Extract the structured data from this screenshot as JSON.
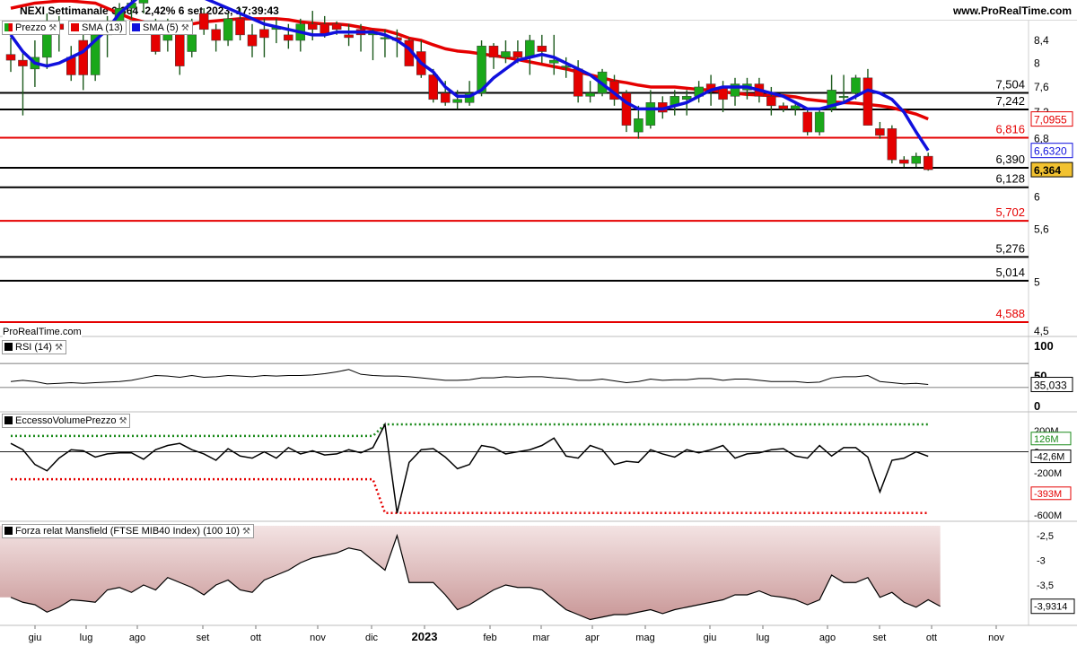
{
  "header": {
    "title": "NEXI Settimanale 6,364 -2,42% 6 set 2023, 17:39:43",
    "site": "www.ProRealTime.com"
  },
  "watermark": "ProRealTime.com",
  "panels": {
    "price": {
      "legend": [
        {
          "label": "Prezzo",
          "color": "#1aa81a"
        },
        {
          "label": "SMA (13)",
          "color": "#e50000"
        },
        {
          "label": "SMA (5)",
          "color": "#1010dd"
        }
      ],
      "yticks": [
        "8,4",
        "8",
        "7,6",
        "7,2",
        "6,8",
        "6",
        "5,6",
        "5",
        "4,5"
      ],
      "tags": [
        {
          "text": "7,0955",
          "color": "#e50000"
        },
        {
          "text": "6,6320",
          "color": "#1010dd"
        },
        {
          "text": "6,364",
          "color": "#000000"
        }
      ],
      "levels": [
        {
          "value": 7.504,
          "label": "7,504",
          "color": "#000000"
        },
        {
          "value": 7.242,
          "label": "7,242",
          "color": "#000000"
        },
        {
          "value": 6.816,
          "label": "6,816",
          "color": "#e50000"
        },
        {
          "value": 6.39,
          "label": "6,390",
          "color": "#000000"
        },
        {
          "value": 6.128,
          "label": "6,128",
          "color": "#000000"
        },
        {
          "value": 5.702,
          "label": "5,702",
          "color": "#e50000"
        },
        {
          "value": 5.276,
          "label": "5,276",
          "color": "#000000"
        },
        {
          "value": 5.014,
          "label": "5,014",
          "color": "#000000"
        },
        {
          "value": 4.588,
          "label": "4,588",
          "color": "#e50000"
        }
      ]
    },
    "rsi": {
      "legend": "RSI (14)",
      "yticks": [
        "100",
        "50",
        "0"
      ],
      "tag": "35,033"
    },
    "excess": {
      "legend": "EccessoVolumePrezzo",
      "yticks": [
        "200M",
        "0",
        "-200M",
        "-600M"
      ],
      "tags": [
        {
          "text": "126M",
          "color": "#1a8a1a"
        },
        {
          "text": "-42,6M",
          "color": "#000000"
        },
        {
          "text": "-393M",
          "color": "#e50000"
        }
      ]
    },
    "mansfield": {
      "legend": "Forza relat Mansfield (FTSE MIB40 Index) (100 10)",
      "yticks": [
        "-2,5",
        "-3",
        "-3,5"
      ],
      "tag": "-3,9314"
    }
  },
  "xaxis": [
    "giu",
    "lug",
    "ago",
    "set",
    "ott",
    "nov",
    "dic",
    "2023",
    "feb",
    "mar",
    "apr",
    "mag",
    "giu",
    "lug",
    "ago",
    "set",
    "ott",
    "nov"
  ],
  "chart_data": [
    {
      "type": "candlestick",
      "title": "NEXI Settimanale",
      "note": "weekly OHLC, approx. first visible week mid-June 2022 to week of 4 Sep 2023",
      "ohlc": [
        [
          8.15,
          8.45,
          7.85,
          8.05
        ],
        [
          8.05,
          8.2,
          7.15,
          7.95
        ],
        [
          7.9,
          8.4,
          7.6,
          8.1
        ],
        [
          8.1,
          8.9,
          7.9,
          8.7
        ],
        [
          8.7,
          8.85,
          8.2,
          8.6
        ],
        [
          8.1,
          8.3,
          7.7,
          7.8
        ],
        [
          8.4,
          8.7,
          7.55,
          7.8
        ],
        [
          7.8,
          8.5,
          7.7,
          8.5
        ],
        [
          8.5,
          8.85,
          8.1,
          8.7
        ],
        [
          8.7,
          9.1,
          8.5,
          9.0
        ],
        [
          9.0,
          9.2,
          8.8,
          9.1
        ],
        [
          9.1,
          9.3,
          8.9,
          9.2
        ],
        [
          8.6,
          8.8,
          8.15,
          8.2
        ],
        [
          8.4,
          8.8,
          8.2,
          8.6
        ],
        [
          8.5,
          8.75,
          7.8,
          7.95
        ],
        [
          8.2,
          8.8,
          8.1,
          8.5
        ],
        [
          8.9,
          9.0,
          8.5,
          8.6
        ],
        [
          8.6,
          8.7,
          8.2,
          8.4
        ],
        [
          8.4,
          8.9,
          8.3,
          8.8
        ],
        [
          8.8,
          9.0,
          8.4,
          8.5
        ],
        [
          8.5,
          8.7,
          8.1,
          8.3
        ],
        [
          8.6,
          8.8,
          8.1,
          8.45
        ],
        [
          8.6,
          8.8,
          8.35,
          8.65
        ],
        [
          8.5,
          8.7,
          8.25,
          8.4
        ],
        [
          8.4,
          8.8,
          8.2,
          8.7
        ],
        [
          8.7,
          8.95,
          8.4,
          8.6
        ],
        [
          8.7,
          8.85,
          8.45,
          8.5
        ],
        [
          8.7,
          8.75,
          8.5,
          8.6
        ],
        [
          8.5,
          8.7,
          8.3,
          8.45
        ],
        [
          8.6,
          8.7,
          8.2,
          8.5
        ],
        [
          8.5,
          8.6,
          8.05,
          8.55
        ],
        [
          8.45,
          8.6,
          8.1,
          8.45
        ],
        [
          8.45,
          8.6,
          8.1,
          8.4
        ],
        [
          8.4,
          8.45,
          7.95,
          7.95
        ],
        [
          8.2,
          8.4,
          7.75,
          7.8
        ],
        [
          7.8,
          7.9,
          7.35,
          7.4
        ],
        [
          7.5,
          7.7,
          7.3,
          7.35
        ],
        [
          7.35,
          7.55,
          7.25,
          7.4
        ],
        [
          7.35,
          7.7,
          7.3,
          7.5
        ],
        [
          7.5,
          8.4,
          7.45,
          8.3
        ],
        [
          8.3,
          8.35,
          7.9,
          8.1
        ],
        [
          8.1,
          8.4,
          8.0,
          8.2
        ],
        [
          8.2,
          8.4,
          8.0,
          8.1
        ],
        [
          8.1,
          8.5,
          7.8,
          8.4
        ],
        [
          8.3,
          8.5,
          8.0,
          8.2
        ],
        [
          8.0,
          8.5,
          7.8,
          8.05
        ],
        [
          7.95,
          8.1,
          7.75,
          7.95
        ],
        [
          7.9,
          8.05,
          7.35,
          7.45
        ],
        [
          7.45,
          7.7,
          7.35,
          7.5
        ],
        [
          7.5,
          7.9,
          7.45,
          7.85
        ],
        [
          7.7,
          7.8,
          7.3,
          7.4
        ],
        [
          7.5,
          7.55,
          6.9,
          7.0
        ],
        [
          6.9,
          7.3,
          6.8,
          7.1
        ],
        [
          7.0,
          7.55,
          6.95,
          7.35
        ],
        [
          7.35,
          7.45,
          7.1,
          7.2
        ],
        [
          7.3,
          7.55,
          7.15,
          7.45
        ],
        [
          7.4,
          7.55,
          7.15,
          7.45
        ],
        [
          7.45,
          7.7,
          7.35,
          7.6
        ],
        [
          7.65,
          7.8,
          7.3,
          7.55
        ],
        [
          7.6,
          7.7,
          7.2,
          7.4
        ],
        [
          7.45,
          7.75,
          7.3,
          7.65
        ],
        [
          7.55,
          7.75,
          7.4,
          7.65
        ],
        [
          7.65,
          7.75,
          7.35,
          7.45
        ],
        [
          7.45,
          7.6,
          7.15,
          7.3
        ],
        [
          7.3,
          7.35,
          7.2,
          7.25
        ],
        [
          7.25,
          7.35,
          7.15,
          7.3
        ],
        [
          7.2,
          7.25,
          6.85,
          6.9
        ],
        [
          6.9,
          7.25,
          6.85,
          7.2
        ],
        [
          7.25,
          7.8,
          7.2,
          7.55
        ],
        [
          7.45,
          7.8,
          7.35,
          7.45
        ],
        [
          7.5,
          7.8,
          7.4,
          7.75
        ],
        [
          7.75,
          7.9,
          7.0,
          7.0
        ],
        [
          6.95,
          7.05,
          6.8,
          6.85
        ],
        [
          6.95,
          7.0,
          6.45,
          6.5
        ],
        [
          6.5,
          6.55,
          6.4,
          6.45
        ],
        [
          6.45,
          6.6,
          6.4,
          6.55
        ],
        [
          6.55,
          6.6,
          6.35,
          6.364
        ]
      ],
      "sma13": [
        9.0,
        9.05,
        9.1,
        9.12,
        9.14,
        9.14,
        9.12,
        9.1,
        9.0,
        8.9,
        8.8,
        8.74,
        8.66,
        8.64,
        8.66,
        8.7,
        8.74,
        8.76,
        8.78,
        8.8,
        8.8,
        8.8,
        8.8,
        8.78,
        8.74,
        8.72,
        8.7,
        8.7,
        8.68,
        8.64,
        8.6,
        8.58,
        8.52,
        8.44,
        8.4,
        8.32,
        8.25,
        8.21,
        8.19,
        8.16,
        8.13,
        8.1,
        8.06,
        8.02,
        7.98,
        7.94,
        7.9,
        7.85,
        7.8,
        7.75,
        7.7,
        7.67,
        7.63,
        7.6,
        7.6,
        7.6,
        7.58,
        7.56,
        7.55,
        7.52,
        7.5,
        7.48,
        7.47,
        7.46,
        7.46,
        7.44,
        7.4,
        7.38,
        7.36,
        7.35,
        7.34,
        7.32,
        7.3,
        7.27,
        7.22,
        7.17,
        7.0955
      ],
      "sma5": [
        8.5,
        8.2,
        8.0,
        7.95,
        8.0,
        8.1,
        8.2,
        8.4,
        8.6,
        8.9,
        9.1,
        9.3,
        9.4,
        9.4,
        9.35,
        9.3,
        9.2,
        9.1,
        9.0,
        8.9,
        8.8,
        8.7,
        8.65,
        8.6,
        8.55,
        8.5,
        8.5,
        8.55,
        8.55,
        8.55,
        8.55,
        8.5,
        8.4,
        8.25,
        8.0,
        7.85,
        7.6,
        7.45,
        7.45,
        7.55,
        7.75,
        7.9,
        8.05,
        8.1,
        8.15,
        8.1,
        8.0,
        7.9,
        7.8,
        7.65,
        7.5,
        7.35,
        7.25,
        7.25,
        7.25,
        7.3,
        7.35,
        7.45,
        7.55,
        7.6,
        7.6,
        7.6,
        7.55,
        7.5,
        7.45,
        7.35,
        7.25,
        7.25,
        7.3,
        7.35,
        7.45,
        7.55,
        7.5,
        7.4,
        7.2,
        6.9,
        6.632
      ]
    },
    {
      "type": "line",
      "title": "RSI (14)",
      "ylim": [
        0,
        100
      ],
      "values": [
        40,
        42,
        40,
        36,
        37,
        38,
        37,
        38,
        39,
        40,
        42,
        46,
        50,
        49,
        47,
        50,
        47,
        48,
        50,
        49,
        48,
        50,
        49,
        50,
        50,
        51,
        53,
        56,
        60,
        52,
        50,
        49,
        49,
        48,
        46,
        44,
        42,
        42,
        43,
        46,
        46,
        48,
        47,
        48,
        48,
        46,
        45,
        42,
        42,
        44,
        41,
        38,
        40,
        44,
        42,
        43,
        43,
        45,
        45,
        42,
        44,
        44,
        42,
        40,
        40,
        40,
        38,
        39,
        46,
        48,
        48,
        50,
        40,
        38,
        36,
        37,
        35.033
      ]
    },
    {
      "type": "line",
      "title": "EccessoVolumePrezzo",
      "unit": "M",
      "ylim": [
        -650,
        260
      ],
      "series": [
        {
          "values": [
            80,
            20,
            -120,
            -180,
            -60,
            20,
            10,
            -50,
            -20,
            -10,
            -10,
            -70,
            20,
            60,
            80,
            20,
            -20,
            -80,
            30,
            -40,
            -60,
            0,
            -60,
            40,
            -20,
            10,
            -30,
            -20,
            20,
            -10,
            40,
            260,
            -580,
            -100,
            20,
            30,
            -50,
            -160,
            -120,
            60,
            40,
            -20,
            0,
            20,
            60,
            130,
            -40,
            -60,
            60,
            20,
            -120,
            -90,
            -100,
            20,
            -20,
            -50,
            20,
            -10,
            20,
            60,
            -60,
            -20,
            -10,
            20,
            30,
            -40,
            -60,
            60,
            -40,
            40,
            40,
            -50,
            -380,
            -80,
            -60,
            0,
            -42.6
          ]
        },
        {
          "values": [
            150,
            150,
            150,
            150,
            150,
            150,
            150,
            150,
            150,
            150,
            150,
            150,
            150,
            150,
            150,
            150,
            150,
            150,
            150,
            150,
            150,
            150,
            150,
            150,
            150,
            150,
            150,
            150,
            150,
            150,
            150,
            260,
            260,
            260,
            260,
            260,
            260,
            260,
            260,
            260,
            260,
            260,
            260,
            260,
            260,
            260,
            260,
            260,
            260,
            260,
            260,
            260,
            260,
            260,
            260,
            260,
            260,
            260,
            260,
            260,
            260,
            260,
            260,
            260,
            260,
            260,
            260,
            260,
            260,
            260,
            260,
            260,
            260,
            260,
            260,
            260,
            260
          ]
        },
        {
          "values": [
            -260,
            -260,
            -260,
            -260,
            -260,
            -260,
            -260,
            -260,
            -260,
            -260,
            -260,
            -260,
            -260,
            -260,
            -260,
            -260,
            -260,
            -260,
            -260,
            -260,
            -260,
            -260,
            -260,
            -260,
            -260,
            -260,
            -260,
            -260,
            -260,
            -260,
            -260,
            -580,
            -580,
            -580,
            -580,
            -580,
            -580,
            -580,
            -580,
            -580,
            -580,
            -580,
            -580,
            -580,
            -580,
            -580,
            -580,
            -580,
            -580,
            -580,
            -580,
            -580,
            -580,
            -580,
            -580,
            -580,
            -580,
            -580,
            -580,
            -580,
            -580,
            -580,
            -580,
            -580,
            -580,
            -580,
            -580,
            -580,
            -580,
            -580,
            -580,
            -580,
            -580,
            -580,
            -580,
            -580,
            -580
          ]
        }
      ]
    },
    {
      "type": "area",
      "title": "Forza relat Mansfield (FTSE MIB40 Index) (100 10)",
      "ylim": [
        -4.3,
        -2.3
      ],
      "values": [
        -3.75,
        -3.85,
        -3.9,
        -4.05,
        -3.95,
        -3.8,
        -3.82,
        -3.85,
        -3.6,
        -3.55,
        -3.65,
        -3.5,
        -3.6,
        -3.35,
        -3.45,
        -3.55,
        -3.7,
        -3.5,
        -3.4,
        -3.6,
        -3.65,
        -3.4,
        -3.3,
        -3.2,
        -3.05,
        -2.95,
        -2.9,
        -2.85,
        -2.75,
        -2.8,
        -3.0,
        -3.2,
        -2.5,
        -3.45,
        -3.45,
        -3.45,
        -3.7,
        -4.0,
        -3.9,
        -3.75,
        -3.6,
        -3.5,
        -3.55,
        -3.55,
        -3.6,
        -3.8,
        -4.0,
        -4.1,
        -4.2,
        -4.15,
        -4.1,
        -4.1,
        -4.05,
        -4.0,
        -4.08,
        -4.0,
        -3.95,
        -3.9,
        -3.85,
        -3.8,
        -3.7,
        -3.7,
        -3.62,
        -3.72,
        -3.75,
        -3.8,
        -3.9,
        -3.8,
        -3.3,
        -3.45,
        -3.45,
        -3.35,
        -3.75,
        -3.65,
        -3.85,
        -3.95,
        -3.8,
        -3.9314
      ]
    }
  ]
}
